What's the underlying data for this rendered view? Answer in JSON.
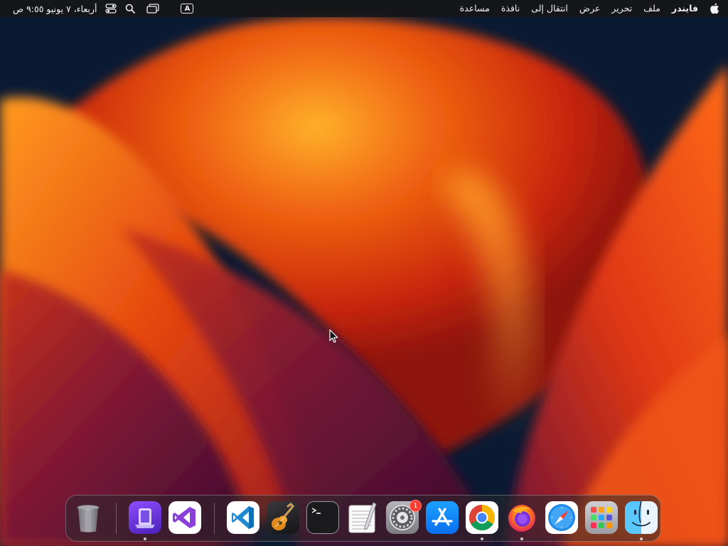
{
  "menubar": {
    "app_name": "فايندر",
    "menus": [
      "ملف",
      "تحرير",
      "عرض",
      "انتقال إلى",
      "نافذة",
      "مساعدة"
    ],
    "clock": "أربعاء، ٧ يونيو ٩:٥٥ ص",
    "input_source": "A"
  },
  "dock": {
    "items": [
      {
        "name": "Finder",
        "running": true
      },
      {
        "name": "Launchpad",
        "running": false
      },
      {
        "name": "Safari",
        "running": false
      },
      {
        "name": "Firefox",
        "running": true
      },
      {
        "name": "Google Chrome",
        "running": true
      },
      {
        "name": "App Store",
        "running": false
      },
      {
        "name": "System Preferences",
        "running": false,
        "badge": "1"
      },
      {
        "name": "TextEdit",
        "running": false
      },
      {
        "name": "Terminal",
        "running": false
      },
      {
        "name": "GarageBand",
        "running": false
      },
      {
        "name": "Visual Studio Code",
        "running": false
      },
      {
        "name": "Visual Studio",
        "running": false
      },
      {
        "name": "Simulator",
        "running": true
      },
      {
        "name": "Trash",
        "running": false
      }
    ]
  },
  "colors": {
    "menubar_bg": "#161618",
    "wallpaper_orange": "#ff8c1a",
    "wallpaper_red": "#c2280f",
    "wallpaper_navy": "#0b1a33",
    "badge_red": "#ff3b30"
  }
}
